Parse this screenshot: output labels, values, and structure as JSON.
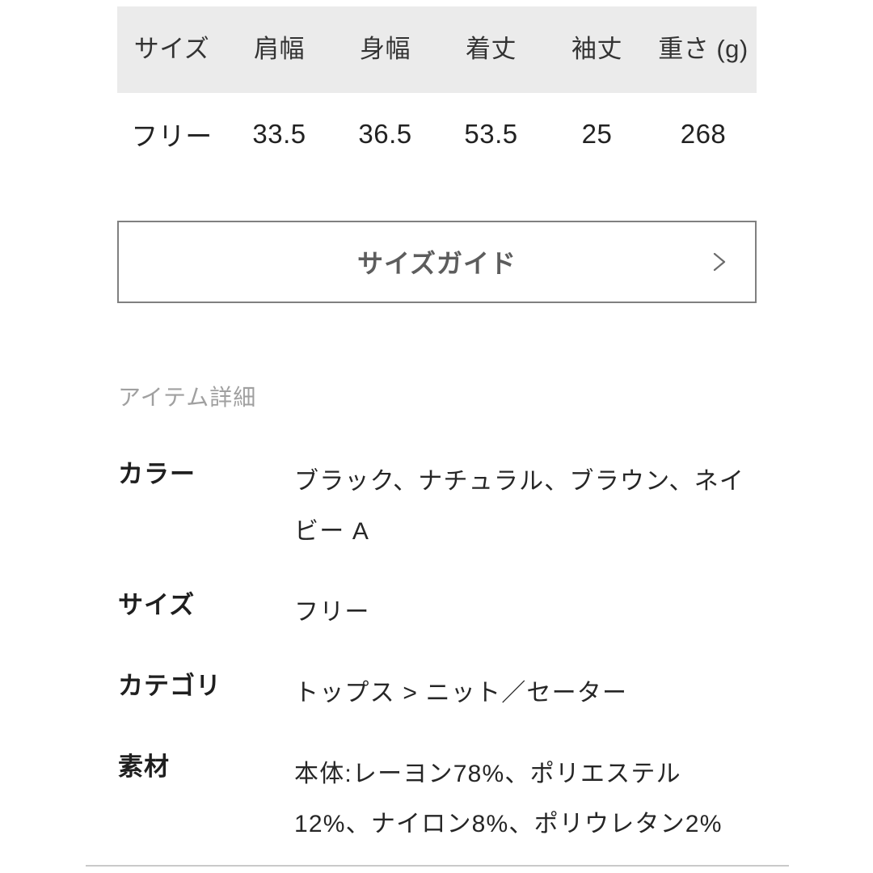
{
  "size_table": {
    "headers": [
      "サイズ",
      "肩幅",
      "身幅",
      "着丈",
      "袖丈",
      "重さ\n(g)"
    ],
    "rows": [
      [
        "フリー",
        "33.5",
        "36.5",
        "53.5",
        "25",
        "268"
      ]
    ]
  },
  "size_guide": {
    "label": "サイズガイド",
    "chevron_icon": "chevron-right-icon"
  },
  "item_detail": {
    "heading": "アイテム詳細",
    "rows": [
      {
        "label": "カラー",
        "value": "ブラック、ナチュラル、ブラウン、ネイビー A"
      },
      {
        "label": "サイズ",
        "value": "フリー"
      },
      {
        "label": "カテゴリ",
        "value": "トップス > ニット／セーター"
      },
      {
        "label": "素材",
        "value": "本体:レーヨン78%、ポリエステル12%、ナイロン8%、ポリウレタン2%"
      }
    ]
  },
  "colors": {
    "table_header_bg": "#ebebeb",
    "table_header_text": "#333333",
    "table_cell_text": "#222222",
    "button_border": "#808080",
    "button_text": "#5d5d5d",
    "section_heading_text": "#a0a0a0",
    "detail_label_text": "#1f1f1f",
    "detail_value_text": "#262626",
    "divider": "#c9c9c9",
    "page_bg": "#ffffff"
  }
}
